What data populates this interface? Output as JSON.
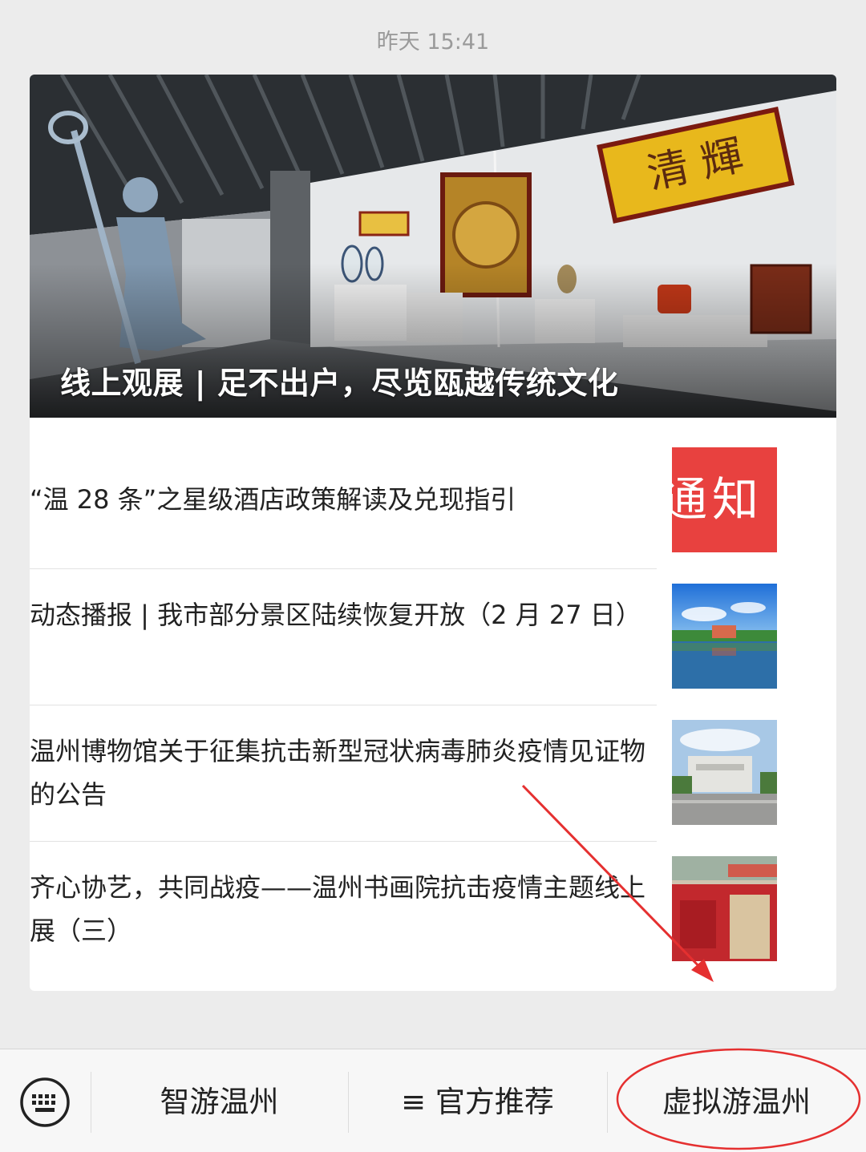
{
  "chat": {
    "timestamp": "昨天 15:41"
  },
  "hero": {
    "title": "线上观展 | 足不出户，尽览瓯越传统文化",
    "plaque_text": "清 輝"
  },
  "articles": [
    {
      "title": "“温 28 条”之星级酒店政策解读及兑现指引",
      "thumb": "notice-image",
      "thumb_text": "通知"
    },
    {
      "title": "动态播报 | 我市部分景区陆续恢复开放（2 月 27 日）",
      "thumb": "lake-scenery-image"
    },
    {
      "title": "温州博物馆关于征集抗击新型冠状病毒肺炎疫情见证物的公告",
      "thumb": "museum-building-image"
    },
    {
      "title": "齐心协艺，共同战疫——温州书画院抗击疫情主题线上展（三）",
      "thumb": "exhibition-photo-image"
    }
  ],
  "bottom_menu": {
    "keyboard_icon": "keyboard-icon",
    "items": [
      {
        "label": "智游温州"
      },
      {
        "label": "官方推荐",
        "prefix": "≡"
      },
      {
        "label": "虚拟游温州"
      }
    ]
  },
  "colors": {
    "annotation": "#e53030",
    "notice_red": "#e8413f"
  }
}
